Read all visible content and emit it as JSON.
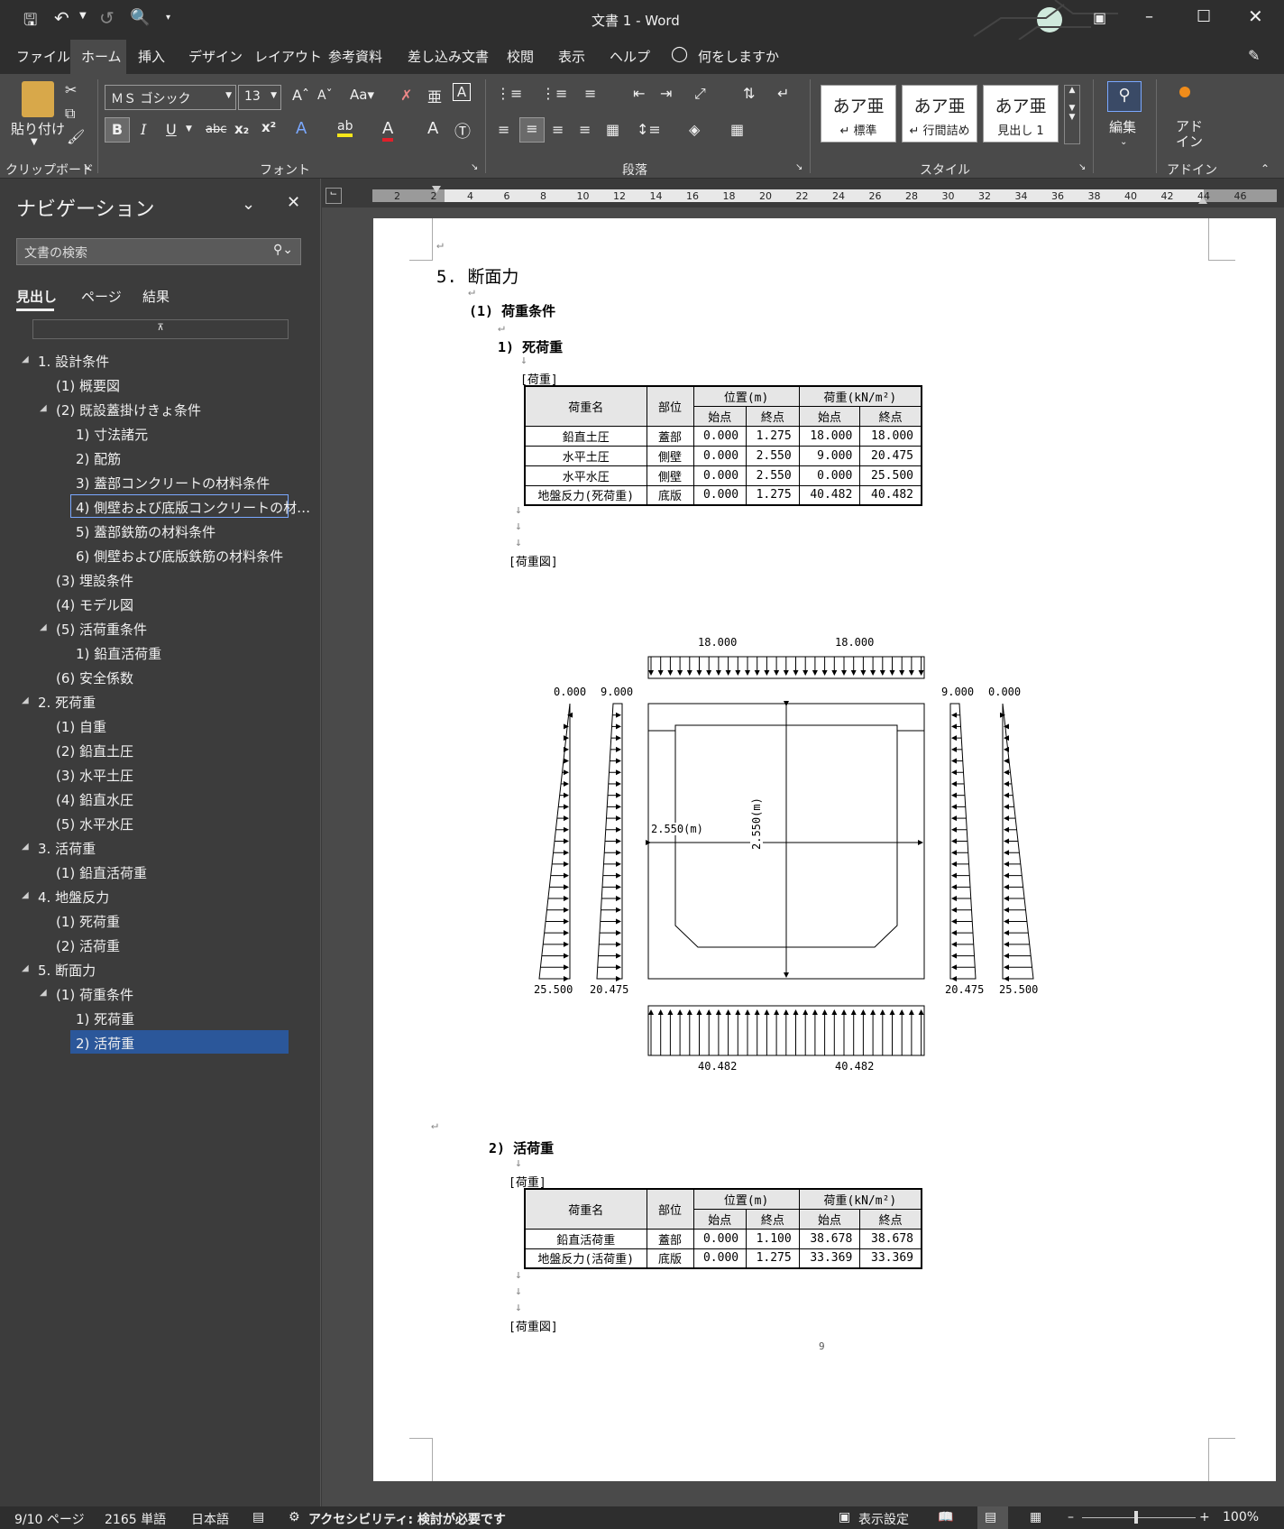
{
  "titlebar": {
    "title": "文書 1  -  Word"
  },
  "tabs": [
    "ファイル",
    "ホーム",
    "挿入",
    "デザイン",
    "レイアウト",
    "参考資料",
    "差し込み文書",
    "校閲",
    "表示",
    "ヘルプ"
  ],
  "tell_me": "何をしますか",
  "ribbon": {
    "paste_label": "貼り付け",
    "font_name": "ＭＳ ゴシック",
    "font_size": "13",
    "groups": {
      "clipboard": "クリップボード",
      "font": "フォント",
      "paragraph": "段落",
      "styles": "スタイル",
      "addin": "アドイン"
    },
    "styles": [
      {
        "sample": "あア亜",
        "name": "↵ 標準"
      },
      {
        "sample": "あア亜",
        "name": "↵ 行間詰め"
      },
      {
        "sample": "あア亜",
        "name": "見出し 1"
      }
    ],
    "edit_label": "編集",
    "addin_label": "アド\nイン"
  },
  "nav": {
    "title": "ナビゲーション",
    "search_placeholder": "文書の検索",
    "tabs": [
      "見出し",
      "ページ",
      "結果"
    ],
    "items": [
      {
        "text": "1. 設計条件",
        "level": 0,
        "tri": true
      },
      {
        "text": "(1) 概要図",
        "level": 1
      },
      {
        "text": "(2) 既設蓋掛けきょ条件",
        "level": 1,
        "tri": true
      },
      {
        "text": "1) 寸法諸元",
        "level": 2
      },
      {
        "text": "2) 配筋",
        "level": 2
      },
      {
        "text": "3) 蓋部コンクリートの材料条件",
        "level": 2
      },
      {
        "text": "4) 側壁および底版コンクリートの材…",
        "level": 2,
        "state": "hover"
      },
      {
        "text": "5) 蓋部鉄筋の材料条件",
        "level": 2
      },
      {
        "text": "6) 側壁および底版鉄筋の材料条件",
        "level": 2
      },
      {
        "text": "(3) 埋設条件",
        "level": 1
      },
      {
        "text": "(4) モデル図",
        "level": 1
      },
      {
        "text": "(5) 活荷重条件",
        "level": 1,
        "tri": true
      },
      {
        "text": "1) 鉛直活荷重",
        "level": 2
      },
      {
        "text": "(6) 安全係数",
        "level": 1
      },
      {
        "text": "2. 死荷重",
        "level": 0,
        "tri": true
      },
      {
        "text": "(1) 自重",
        "level": 1
      },
      {
        "text": "(2) 鉛直土圧",
        "level": 1
      },
      {
        "text": "(3) 水平土圧",
        "level": 1
      },
      {
        "text": "(4) 鉛直水圧",
        "level": 1
      },
      {
        "text": "(5) 水平水圧",
        "level": 1
      },
      {
        "text": "3. 活荷重",
        "level": 0,
        "tri": true
      },
      {
        "text": "(1) 鉛直活荷重",
        "level": 1
      },
      {
        "text": "4. 地盤反力",
        "level": 0,
        "tri": true
      },
      {
        "text": "(1) 死荷重",
        "level": 1
      },
      {
        "text": "(2) 活荷重",
        "level": 1
      },
      {
        "text": "5. 断面力",
        "level": 0,
        "tri": true
      },
      {
        "text": "(1) 荷重条件",
        "level": 1,
        "tri": true
      },
      {
        "text": "1) 死荷重",
        "level": 2
      },
      {
        "text": "2) 活荷重",
        "level": 2,
        "state": "selected"
      }
    ]
  },
  "ruler_ticks": [
    "2",
    "2",
    "4",
    "6",
    "8",
    "10",
    "12",
    "14",
    "16",
    "18",
    "20",
    "22",
    "24",
    "26",
    "28",
    "30",
    "32",
    "34",
    "36",
    "38",
    "40",
    "42",
    "44",
    "46"
  ],
  "doc": {
    "h1": "5. 断面力",
    "h2": "(1) 荷重条件",
    "h3a": "1) 死荷重",
    "h3b": "2) 活荷重",
    "load_label": "[荷重]",
    "fig_label": "[荷重図]",
    "table_headers": {
      "name": "荷重名",
      "part": "部位",
      "pos": "位置(m)",
      "load": "荷重(kN/m²)",
      "start": "始点",
      "end": "終点"
    },
    "table1": [
      [
        "鉛直土圧",
        "蓋部",
        "0.000",
        "1.275",
        "18.000",
        "18.000"
      ],
      [
        "水平土圧",
        "側壁",
        "0.000",
        "2.550",
        "9.000",
        "20.475"
      ],
      [
        "水平水圧",
        "側壁",
        "0.000",
        "2.550",
        "0.000",
        "25.500"
      ],
      [
        "地盤反力(死荷重)",
        "底版",
        "0.000",
        "1.275",
        "40.482",
        "40.482"
      ]
    ],
    "table2": [
      [
        "鉛直活荷重",
        "蓋部",
        "0.000",
        "1.100",
        "38.678",
        "38.678"
      ],
      [
        "地盤反力(活荷重)",
        "底版",
        "0.000",
        "1.275",
        "33.369",
        "33.369"
      ]
    ],
    "diagram": {
      "top_left": "18.000",
      "top_right": "18.000",
      "left_outer_top": "0.000",
      "left_inner_top": "9.000",
      "right_inner_top": "9.000",
      "right_outer_top": "0.000",
      "left_outer_bottom": "25.500",
      "left_inner_bottom": "20.475",
      "right_inner_bottom": "20.475",
      "right_outer_bottom": "25.500",
      "bottom_left": "40.482",
      "bottom_right": "40.482",
      "width_label": "2.550(m)",
      "height_label": "2.550(m)"
    },
    "page_number": "9"
  },
  "status": {
    "page": "9/10 ページ",
    "words": "2165 単語",
    "lang": "日本語",
    "accessibility": "アクセシビリティ: 検討が必要です",
    "display_settings": "表示設定",
    "zoom": "100%"
  }
}
